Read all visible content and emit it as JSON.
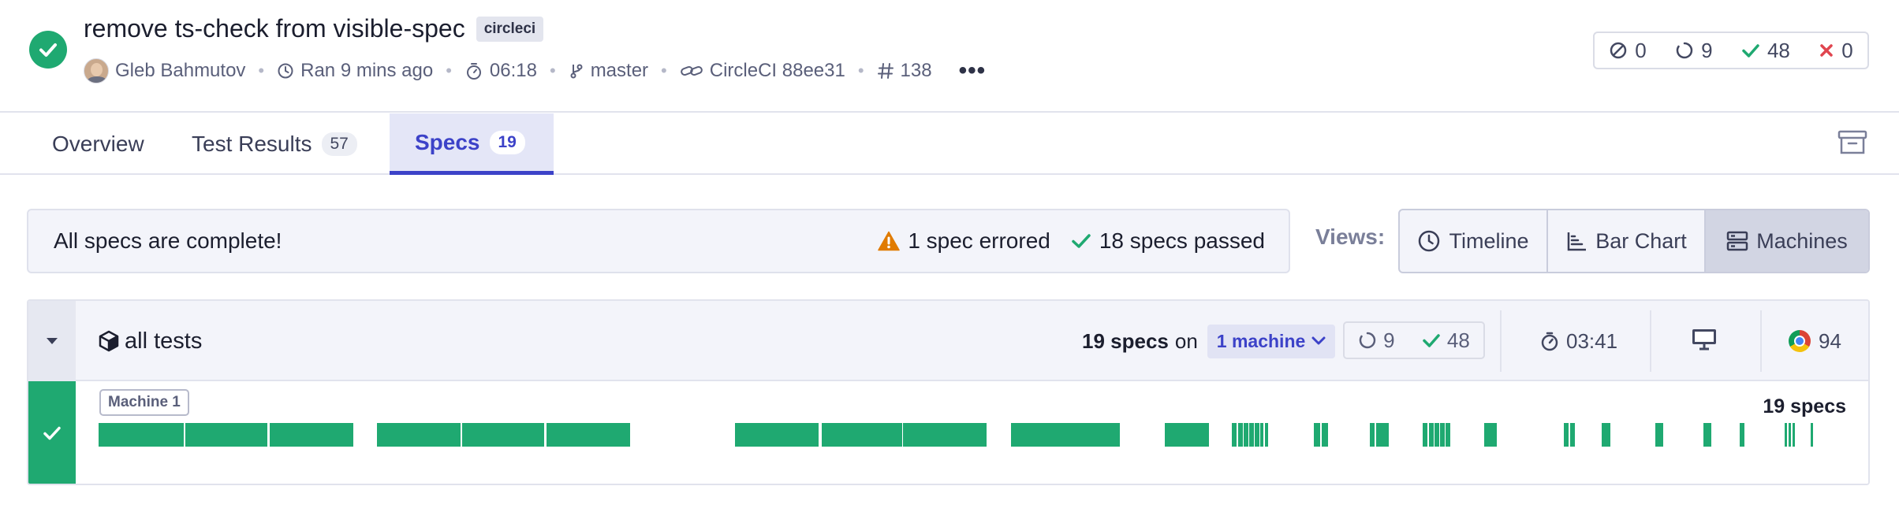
{
  "run": {
    "title": "remove ts-check from visible-spec",
    "ci_tag": "circleci",
    "author": "Gleb Bahmutov",
    "ran": "Ran 9 mins ago",
    "duration": "06:18",
    "branch": "master",
    "commit": "CircleCI 88ee31",
    "run_number": "138",
    "more": "•••",
    "status": "passed"
  },
  "counts": {
    "skipped": "0",
    "pending": "9",
    "passed": "48",
    "failed": "0"
  },
  "tabs": [
    {
      "label": "Overview"
    },
    {
      "label": "Test Results",
      "count": "57"
    },
    {
      "label": "Specs",
      "count": "19",
      "active": true
    }
  ],
  "banner": {
    "message": "All specs are complete!",
    "errored": "1 spec errored",
    "passed": "18 specs passed"
  },
  "views": {
    "label": "Views:",
    "options": [
      "Timeline",
      "Bar Chart",
      "Machines"
    ],
    "selected": "Machines"
  },
  "group": {
    "title": "all tests",
    "specs": "19 specs",
    "on": "on",
    "machines": "1 machine",
    "pending": "9",
    "passed": "48",
    "duration": "03:41",
    "os_icon": "desktop-icon",
    "browser_icon": "chrome-icon",
    "browser_version": "94",
    "machine_label": "Machine 1",
    "machine_specs": "19 specs"
  },
  "colors": {
    "pass": "#1fa971",
    "warn": "#e07b00",
    "fail": "#e0454f",
    "accent": "#3c42c8"
  }
}
